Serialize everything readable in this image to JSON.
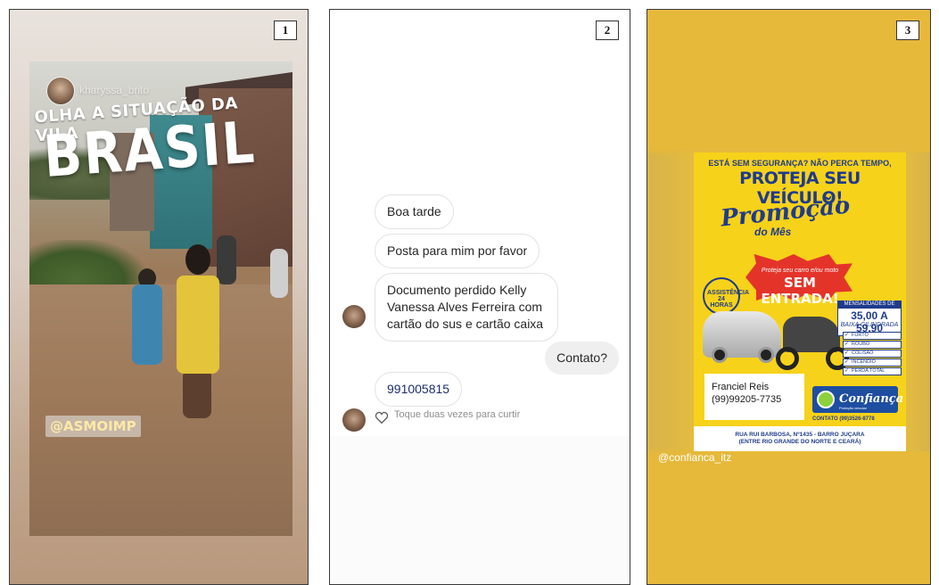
{
  "panels": [
    {
      "number": "1"
    },
    {
      "number": "2"
    },
    {
      "number": "3"
    }
  ],
  "story1": {
    "username": "kharyssa_brito",
    "caption_line1": "OLHA A SITUAÇÃO DA VILA",
    "caption_line2": "BRASIL",
    "tag": "@ASMOIMP"
  },
  "chat": {
    "incoming_messages": [
      "Boa tarde",
      "Posta para mim por favor",
      "Documento perdido Kelly Vanessa Alves Ferreira com cartão do sus e cartão caixa"
    ],
    "outgoing_message": "Contato?",
    "reply": "991005815",
    "like_hint": "Toque duas vezes para curtir"
  },
  "story3": {
    "handle": "@confianca_itz",
    "ad": {
      "headline_small": "ESTÁ SEM SEGURANÇA? NÃO PERCA TEMPO,",
      "headline_big": "PROTEJA SEU VEÍCULO!",
      "promo_word": "Promoção",
      "promo_suffix": "do Mês",
      "burst_small": "Proteja seu carro e/ou moto",
      "burst_big": "SEM ENTRADA!",
      "badge_text": "ASSISTÊNCIA 24 HORAS",
      "mens_label": "MENSALIDADES DE",
      "price": "35,00 A 59,90",
      "cilindrada": "BAIXA CILINDRADA",
      "features": [
        "FURTO",
        "ROUBO",
        "COLISÃO",
        "INCÊNDIO",
        "PERDA TOTAL"
      ],
      "contact_name": "Franciel Reis",
      "contact_phone": "(99)99205-7735",
      "brand": "Confiança",
      "brand_sub": "Proteção veicular",
      "contact_line": "CONTATO (99)3526-8778",
      "address_line1": "RUA RUI BARBOSA, Nº1435 - BARRO JUÇARA",
      "address_line2": "(ENTRE RIO GRANDE DO NORTE E CEARÁ)"
    }
  }
}
